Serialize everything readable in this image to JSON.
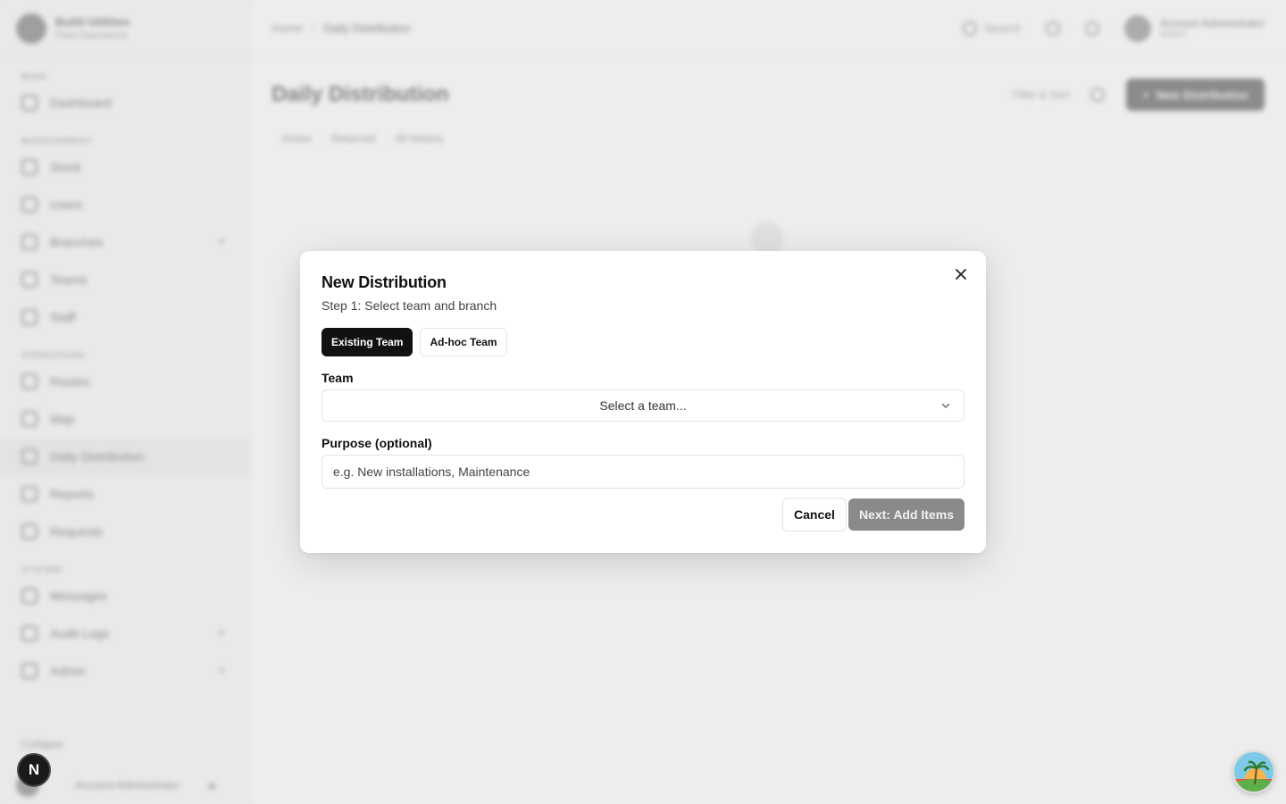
{
  "background": {
    "brand": {
      "name": "Build Utilities",
      "subtitle": "Field Operations"
    },
    "nav": {
      "section_main": "MAIN",
      "dashboard": "Dashboard",
      "section_management": "MANAGEMENT",
      "stock": "Stock",
      "users": "Users",
      "branches": "Branches",
      "teams": "Teams",
      "staff": "Staff",
      "section_operations": "OPERATIONS",
      "routes": "Routes",
      "map": "Map",
      "daily_distribution": "Daily Distribution",
      "reports": "Reports",
      "requests": "Requests",
      "section_system": "SYSTEM",
      "messages": "Messages",
      "audit_logs": "Audit Logs",
      "admin": "Admin",
      "collapse": "Collapse",
      "user_name": "Account Administrator"
    },
    "topbar": {
      "breadcrumb_root": "Home",
      "breadcrumb_sep": "/",
      "breadcrumb_current": "Daily Distribution",
      "search": "Search",
      "user_name": "Account Administrator",
      "user_role": "Admin"
    },
    "page": {
      "title": "Daily Distribution",
      "sub_link": "Filter & Sort",
      "primary_button": "New Distribution"
    },
    "tabs": [
      "Active",
      "Returned",
      "All History"
    ]
  },
  "modal": {
    "title": "New Distribution",
    "step": "Step 1: Select team and branch",
    "tab_existing": "Existing Team",
    "tab_adhoc": "Ad-hoc Team",
    "team_label": "Team",
    "team_select_placeholder": "Select a team...",
    "purpose_label": "Purpose (optional)",
    "purpose_placeholder": "e.g. New installations, Maintenance",
    "cancel_label": "Cancel",
    "next_label": "Next: Add Items"
  },
  "widgets": {
    "n_badge": "N"
  },
  "colors": {
    "primary": "#111111",
    "disabled": "#8a8a8a",
    "border": "#e3e3e3"
  }
}
